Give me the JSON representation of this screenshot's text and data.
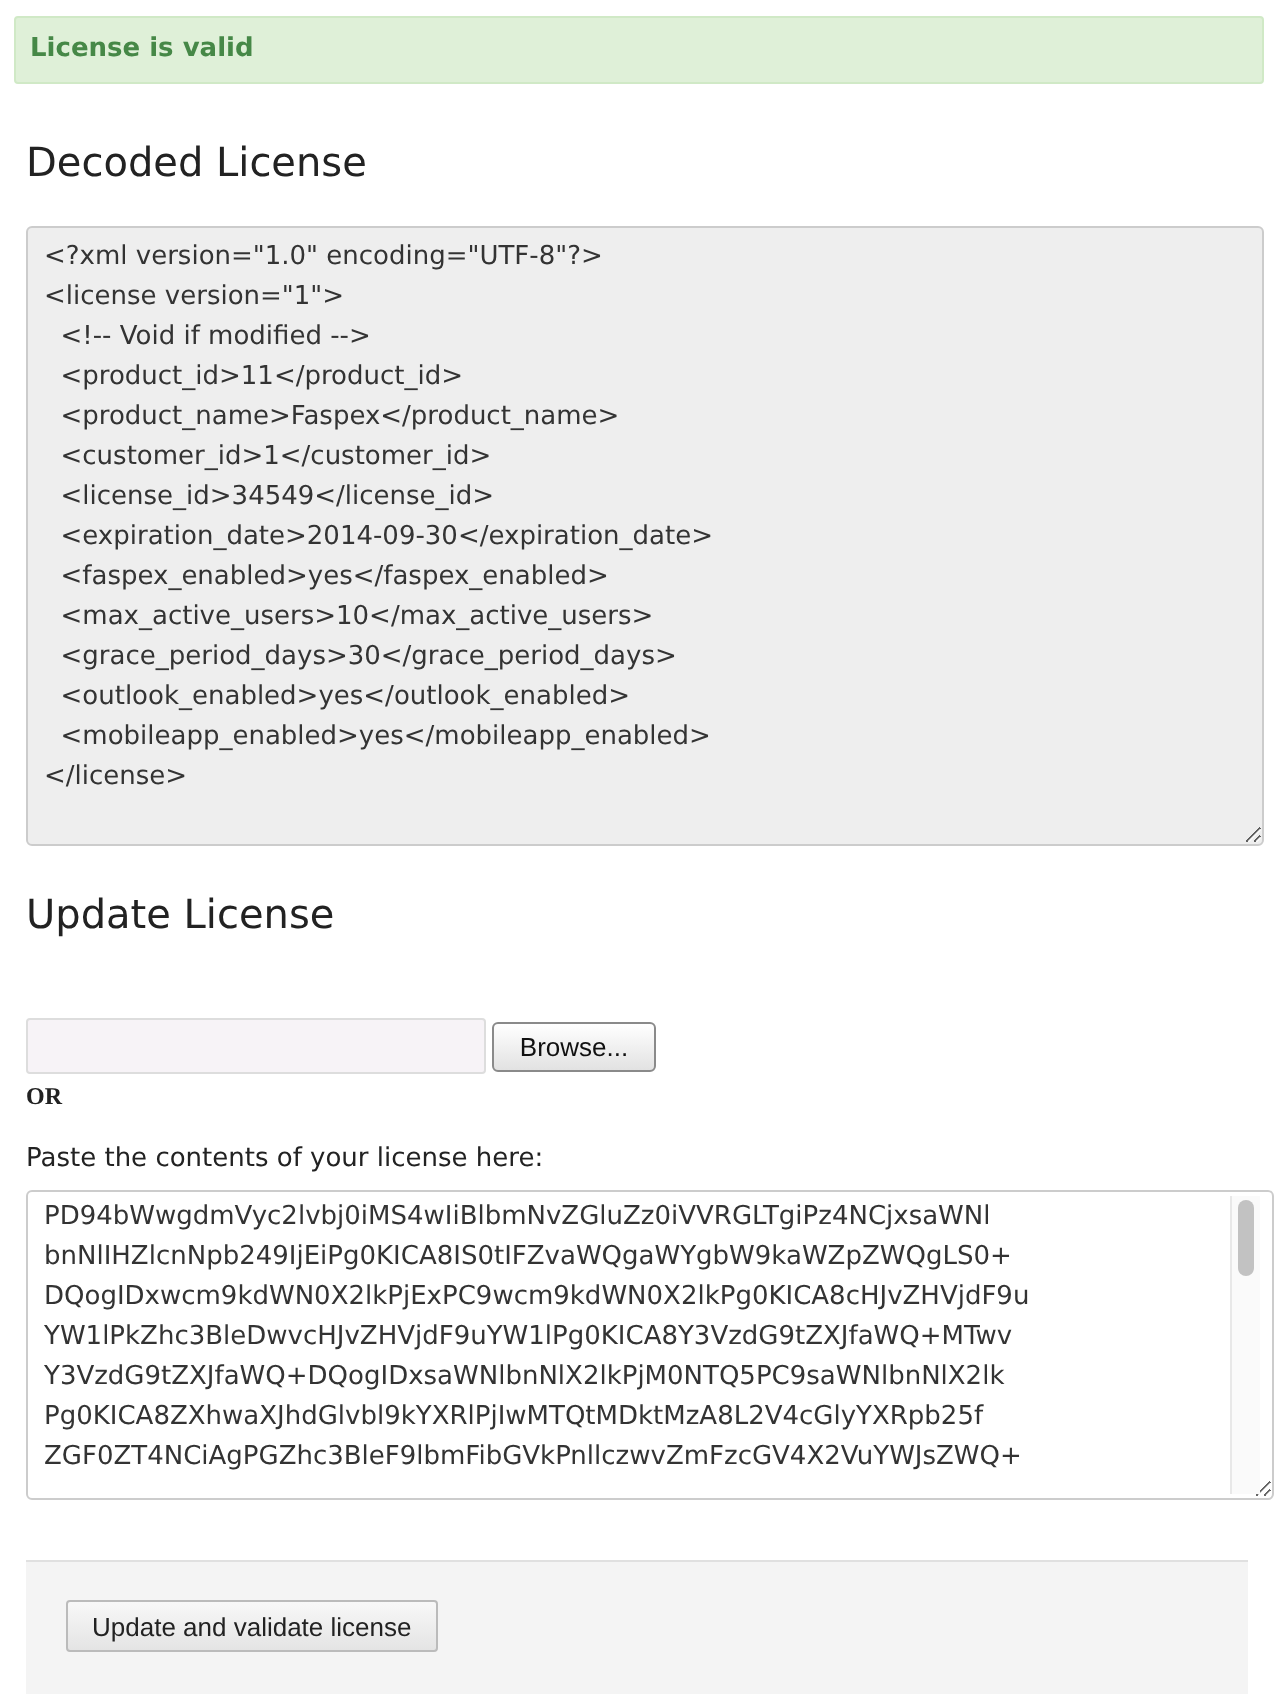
{
  "alert": {
    "kind": "success",
    "text": "License is valid"
  },
  "decoded_license": {
    "heading": "Decoded License",
    "lines": [
      "<?xml version=\"1.0\" encoding=\"UTF-8\"?>",
      "<license version=\"1\">",
      "  <!-- Void if modified -->",
      "  <product_id>11</product_id>",
      "  <product_name>Faspex</product_name>",
      "  <customer_id>1</customer_id>",
      "  <license_id>34549</license_id>",
      "  <expiration_date>2014-09-30</expiration_date>",
      "  <faspex_enabled>yes</faspex_enabled>",
      "  <max_active_users>10</max_active_users>",
      "  <grace_period_days>30</grace_period_days>",
      "  <outlook_enabled>yes</outlook_enabled>",
      "  <mobileapp_enabled>yes</mobileapp_enabled>",
      "</license>"
    ]
  },
  "update_license": {
    "heading": "Update License",
    "browse_button": "Browse...",
    "separator": "OR",
    "paste_label": "Paste the contents of your license here:",
    "paste_lines": [
      "PD94bWwgdmVyc2lvbj0iMS4wIiBlbmNvZGluZz0iVVRGLTgiPz4NCjxsaWNl",
      "bnNlIHZlcnNpb249IjEiPg0KICA8IS0tIFZvaWQgaWYgbW9kaWZpZWQgLS0+",
      "DQogIDxwcm9kdWN0X2lkPjExPC9wcm9kdWN0X2lkPg0KICA8cHJvZHVjdF9u",
      "YW1lPkZhc3BleDwvcHJvZHVjdF9uYW1lPg0KICA8Y3VzdG9tZXJfaWQ+MTwv",
      "Y3VzdG9tZXJfaWQ+DQogIDxsaWNlbnNlX2lkPjM0NTQ5PC9saWNlbnNlX2lk",
      "Pg0KICA8ZXhwaXJhdGlvbl9kYXRlPjIwMTQtMDktMzA8L2V4cGlyYXRpb25f",
      "ZGF0ZT4NCiAgPGZhc3BleF9lbmFibGVkPnllczwvZmFzcGV4X2VuYWJsZWQ+"
    ]
  },
  "actions": {
    "buttons": [
      "Update and validate license"
    ]
  }
}
